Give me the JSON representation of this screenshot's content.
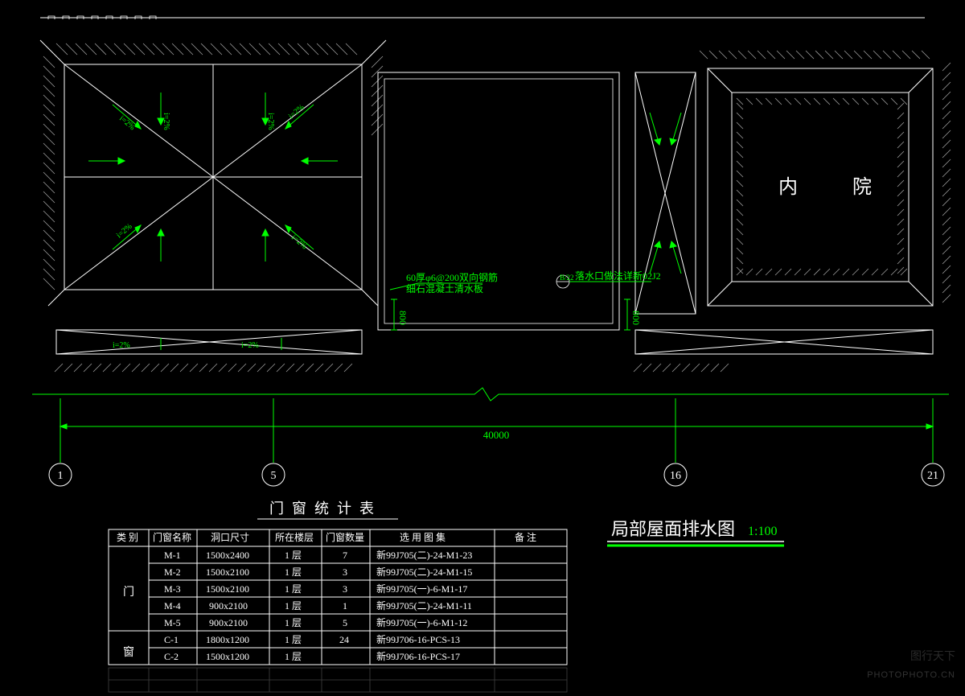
{
  "drawing": {
    "title": "局部屋面排水图",
    "scale": "1:100",
    "courtyard_label": "内　院",
    "total_dim": "40000",
    "vert_dim_a": "800",
    "vert_dim_b": "800",
    "slope_label": "i=2%",
    "note_line1": "60厚φ6@200双向钢筋",
    "note_line2": "细石混凝土清水板",
    "note_line3": "落水口做法详新02J2",
    "detail_ref": "B/22",
    "grid_labels": [
      "1",
      "5",
      "16",
      "21"
    ]
  },
  "table": {
    "title": "门窗统计表",
    "headers": [
      "类 别",
      "门窗名称",
      "洞口尺寸",
      "所在楼层",
      "门窗数量",
      "选 用 图 集",
      "备  注"
    ],
    "cat_door": "门",
    "cat_window": "窗",
    "rows": [
      {
        "name": "M-1",
        "size": "1500x2400",
        "floor": "1 层",
        "qty": "7",
        "atlas": "新99J705(二)-24-M1-23",
        "remark": ""
      },
      {
        "name": "M-2",
        "size": "1500x2100",
        "floor": "1 层",
        "qty": "3",
        "atlas": "新99J705(二)-24-M1-15",
        "remark": ""
      },
      {
        "name": "M-3",
        "size": "1500x2100",
        "floor": "1 层",
        "qty": "3",
        "atlas": "新99J705(一)-6-M1-17",
        "remark": ""
      },
      {
        "name": "M-4",
        "size": "900x2100",
        "floor": "1 层",
        "qty": "1",
        "atlas": "新99J705(二)-24-M1-11",
        "remark": ""
      },
      {
        "name": "M-5",
        "size": "900x2100",
        "floor": "1 层",
        "qty": "5",
        "atlas": "新99J705(一)-6-M1-12",
        "remark": ""
      },
      {
        "name": "C-1",
        "size": "1800x1200",
        "floor": "1 层",
        "qty": "24",
        "atlas": "新99J706-16-PCS-13",
        "remark": ""
      },
      {
        "name": "C-2",
        "size": "1500x1200",
        "floor": "1 层",
        "qty": "",
        "atlas": "新99J706-16-PCS-17",
        "remark": ""
      }
    ]
  },
  "watermark": {
    "cn": "图行天下",
    "en": "PHOTOPHOTO.CN"
  }
}
